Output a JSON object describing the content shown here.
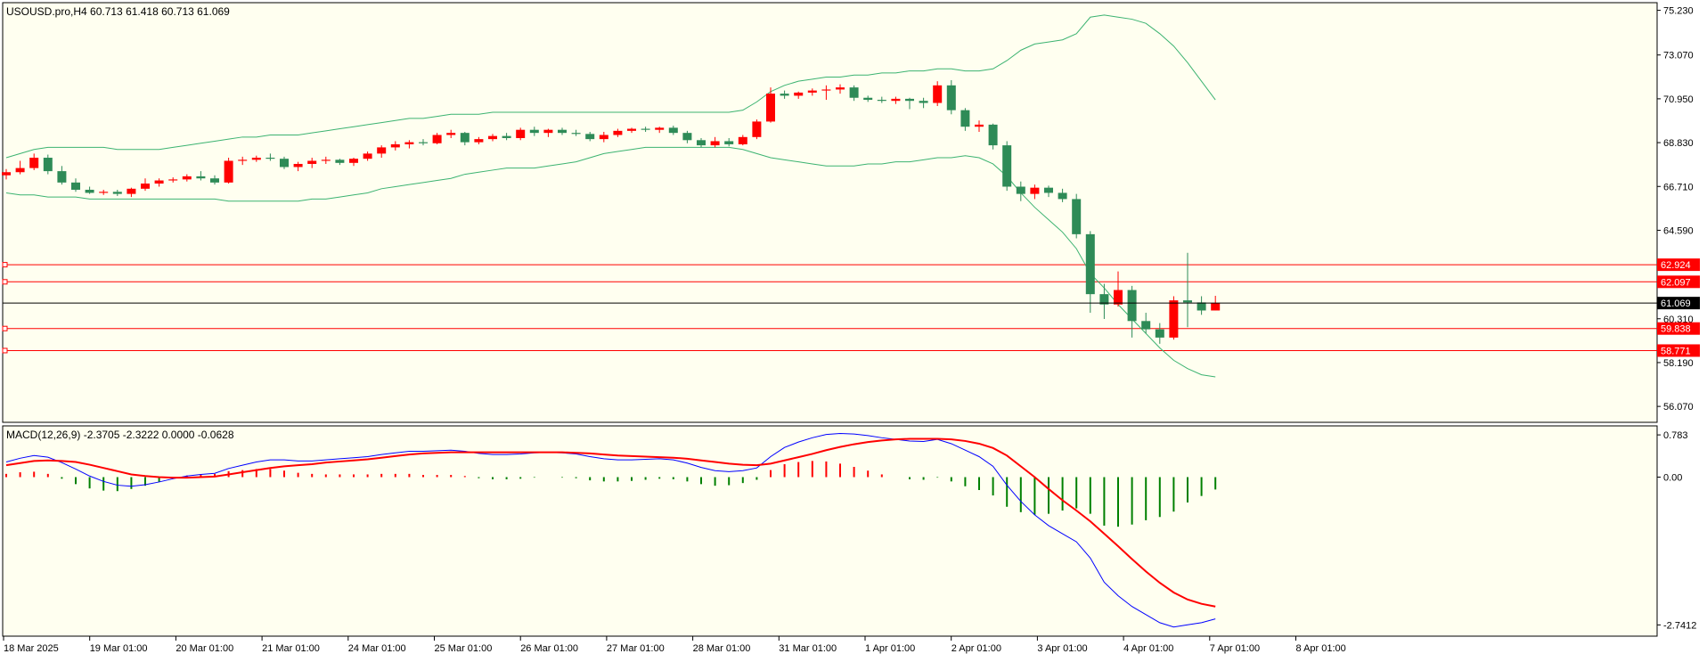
{
  "header": {
    "symbol_info": "USOUSD.pro,H4  60.713 61.418 60.713 61.069",
    "macd_info": "MACD(12,26,9) -2.3705 -2.3222 0.0000 -0.0628"
  },
  "colors": {
    "background": "#FFFFF0",
    "bull_candle": "#FF0000",
    "bear_candle": "#2E8B57",
    "bands": "#3CB371",
    "level_lines": "#FF0000",
    "price_line": "#000000",
    "macd_main": "#0000FF",
    "macd_signal": "#FF0000",
    "hist_pos": "#FF0000",
    "hist_neg": "#008000"
  },
  "chart_data": [
    {
      "type": "candlestick",
      "title": "USOUSD.pro,H4",
      "ylim": [
        55.3,
        75.6
      ],
      "y_ticks": [
        "75.230",
        "73.070",
        "70.950",
        "68.830",
        "66.710",
        "64.590",
        "60.310",
        "58.190",
        "56.070"
      ],
      "current_price": "61.069",
      "horizontal_levels": [
        "62.924",
        "62.097",
        "59.838",
        "58.771"
      ],
      "x_ticks": [
        "18 Mar 2025",
        "19 Mar 01:00",
        "20 Mar 01:00",
        "21 Mar 01:00",
        "24 Mar 01:00",
        "25 Mar 01:00",
        "26 Mar 01:00",
        "27 Mar 01:00",
        "28 Mar 01:00",
        "31 Mar 01:00",
        "1 Apr 01:00",
        "2 Apr 01:00",
        "3 Apr 01:00",
        "4 Apr 01:00",
        "7 Apr 01:00",
        "8 Apr 01:00"
      ],
      "ohlc": [
        [
          67.25,
          67.55,
          67.05,
          67.4
        ],
        [
          67.4,
          67.95,
          67.3,
          67.6
        ],
        [
          67.6,
          68.3,
          67.5,
          68.1
        ],
        [
          68.1,
          68.25,
          67.3,
          67.45
        ],
        [
          67.45,
          67.7,
          66.8,
          66.9
        ],
        [
          66.9,
          67.1,
          66.45,
          66.55
        ],
        [
          66.55,
          66.7,
          66.35,
          66.4
        ],
        [
          66.4,
          66.55,
          66.3,
          66.45
        ],
        [
          66.45,
          66.55,
          66.25,
          66.35
        ],
        [
          66.35,
          66.65,
          66.2,
          66.6
        ],
        [
          66.6,
          67.1,
          66.5,
          66.85
        ],
        [
          66.85,
          67.1,
          66.7,
          67.0
        ],
        [
          67.0,
          67.15,
          66.9,
          67.05
        ],
        [
          67.05,
          67.3,
          66.95,
          67.2
        ],
        [
          67.2,
          67.45,
          67.0,
          67.1
        ],
        [
          67.1,
          67.25,
          66.8,
          66.9
        ],
        [
          66.9,
          68.1,
          66.85,
          67.95
        ],
        [
          67.95,
          68.15,
          67.75,
          68.0
        ],
        [
          68.0,
          68.2,
          67.9,
          68.1
        ],
        [
          68.1,
          68.3,
          67.95,
          68.05
        ],
        [
          68.05,
          68.15,
          67.55,
          67.65
        ],
        [
          67.65,
          67.9,
          67.45,
          67.8
        ],
        [
          67.8,
          68.1,
          67.6,
          67.95
        ],
        [
          67.95,
          68.15,
          67.8,
          68.0
        ],
        [
          68.0,
          68.05,
          67.75,
          67.85
        ],
        [
          67.85,
          68.1,
          67.7,
          68.05
        ],
        [
          68.05,
          68.4,
          67.95,
          68.3
        ],
        [
          68.3,
          68.7,
          68.1,
          68.6
        ],
        [
          68.6,
          68.9,
          68.45,
          68.75
        ],
        [
          68.75,
          68.95,
          68.55,
          68.85
        ],
        [
          68.85,
          69.0,
          68.7,
          68.8
        ],
        [
          68.8,
          69.3,
          68.75,
          69.2
        ],
        [
          69.2,
          69.45,
          69.05,
          69.3
        ],
        [
          69.3,
          69.35,
          68.7,
          68.85
        ],
        [
          68.85,
          69.1,
          68.75,
          69.0
        ],
        [
          69.0,
          69.25,
          68.9,
          69.15
        ],
        [
          69.15,
          69.3,
          68.95,
          69.05
        ],
        [
          69.05,
          69.55,
          68.95,
          69.45
        ],
        [
          69.45,
          69.6,
          69.15,
          69.3
        ],
        [
          69.3,
          69.5,
          69.1,
          69.45
        ],
        [
          69.45,
          69.55,
          69.2,
          69.3
        ],
        [
          69.3,
          69.45,
          69.15,
          69.25
        ],
        [
          69.25,
          69.35,
          68.9,
          69.0
        ],
        [
          69.0,
          69.35,
          68.85,
          69.2
        ],
        [
          69.2,
          69.5,
          69.1,
          69.4
        ],
        [
          69.4,
          69.55,
          69.3,
          69.5
        ],
        [
          69.5,
          69.6,
          69.35,
          69.45
        ],
        [
          69.45,
          69.6,
          69.3,
          69.55
        ],
        [
          69.55,
          69.65,
          69.2,
          69.3
        ],
        [
          69.3,
          69.4,
          68.8,
          68.95
        ],
        [
          68.95,
          69.05,
          68.6,
          68.7
        ],
        [
          68.7,
          69.1,
          68.6,
          68.9
        ],
        [
          68.9,
          69.05,
          68.65,
          68.75
        ],
        [
          68.75,
          69.2,
          68.7,
          69.1
        ],
        [
          69.1,
          69.95,
          69.0,
          69.85
        ],
        [
          69.85,
          71.5,
          69.8,
          71.2
        ],
        [
          71.2,
          71.35,
          70.95,
          71.1
        ],
        [
          71.1,
          71.3,
          70.95,
          71.25
        ],
        [
          71.25,
          71.45,
          71.1,
          71.35
        ],
        [
          71.35,
          71.6,
          70.9,
          71.4
        ],
        [
          71.4,
          71.65,
          71.2,
          71.5
        ],
        [
          71.5,
          71.6,
          70.85,
          71.0
        ],
        [
          71.0,
          71.1,
          70.8,
          70.9
        ],
        [
          70.9,
          71.05,
          70.75,
          70.85
        ],
        [
          70.85,
          71.05,
          70.7,
          70.95
        ],
        [
          70.95,
          71.0,
          70.45,
          70.85
        ],
        [
          70.85,
          71.0,
          70.5,
          70.75
        ],
        [
          70.75,
          71.8,
          70.6,
          71.6
        ],
        [
          71.6,
          71.85,
          70.2,
          70.4
        ],
        [
          70.4,
          70.5,
          69.4,
          69.6
        ],
        [
          69.6,
          69.9,
          69.35,
          69.7
        ],
        [
          69.7,
          69.75,
          68.5,
          68.7
        ],
        [
          68.7,
          68.9,
          66.5,
          66.7
        ],
        [
          66.7,
          66.95,
          66.0,
          66.35
        ],
        [
          66.35,
          66.8,
          66.1,
          66.65
        ],
        [
          66.65,
          66.75,
          66.2,
          66.4
        ],
        [
          66.4,
          66.6,
          65.95,
          66.1
        ],
        [
          66.1,
          66.35,
          64.2,
          64.4
        ],
        [
          64.4,
          64.55,
          60.6,
          61.5
        ],
        [
          61.5,
          62.0,
          60.3,
          61.0
        ],
        [
          61.0,
          62.6,
          60.9,
          61.7
        ],
        [
          61.7,
          61.9,
          59.4,
          60.2
        ],
        [
          60.2,
          60.6,
          59.6,
          59.8
        ],
        [
          59.8,
          60.1,
          59.1,
          59.4
        ],
        [
          59.4,
          61.4,
          59.3,
          61.2
        ],
        [
          61.2,
          63.5,
          59.9,
          61.1
        ],
        [
          61.1,
          61.4,
          60.5,
          60.71
        ],
        [
          60.71,
          61.42,
          60.71,
          61.07
        ]
      ],
      "bollinger": {
        "upper": [
          68.1,
          68.3,
          68.5,
          68.6,
          68.6,
          68.6,
          68.6,
          68.6,
          68.5,
          68.5,
          68.5,
          68.5,
          68.6,
          68.7,
          68.8,
          68.9,
          69.0,
          69.1,
          69.1,
          69.2,
          69.2,
          69.2,
          69.3,
          69.4,
          69.5,
          69.6,
          69.7,
          69.8,
          69.9,
          70.0,
          70.0,
          70.1,
          70.2,
          70.2,
          70.2,
          70.3,
          70.3,
          70.3,
          70.3,
          70.3,
          70.3,
          70.3,
          70.3,
          70.3,
          70.3,
          70.3,
          70.3,
          70.3,
          70.3,
          70.3,
          70.3,
          70.3,
          70.3,
          70.4,
          70.8,
          71.3,
          71.6,
          71.8,
          71.9,
          72.0,
          72.0,
          72.1,
          72.1,
          72.2,
          72.2,
          72.3,
          72.3,
          72.4,
          72.4,
          72.3,
          72.3,
          72.4,
          72.8,
          73.3,
          73.6,
          73.7,
          73.8,
          74.1,
          74.9,
          75.0,
          74.9,
          74.8,
          74.6,
          74.1,
          73.5,
          72.7,
          71.8,
          70.9
        ],
        "lower": [
          66.4,
          66.3,
          66.3,
          66.2,
          66.2,
          66.2,
          66.1,
          66.1,
          66.1,
          66.1,
          66.1,
          66.1,
          66.1,
          66.1,
          66.1,
          66.1,
          66.0,
          66.0,
          66.0,
          66.0,
          66.0,
          66.0,
          66.1,
          66.1,
          66.2,
          66.3,
          66.4,
          66.6,
          66.7,
          66.8,
          66.9,
          67.0,
          67.1,
          67.3,
          67.4,
          67.5,
          67.6,
          67.6,
          67.6,
          67.7,
          67.8,
          67.9,
          68.1,
          68.3,
          68.4,
          68.5,
          68.6,
          68.6,
          68.6,
          68.6,
          68.6,
          68.6,
          68.6,
          68.5,
          68.3,
          68.1,
          68.0,
          67.9,
          67.8,
          67.7,
          67.7,
          67.7,
          67.8,
          67.8,
          67.9,
          67.9,
          68.0,
          68.1,
          68.1,
          68.2,
          68.1,
          67.8,
          67.2,
          66.4,
          65.7,
          65.1,
          64.5,
          63.7,
          62.5,
          61.8,
          61.0,
          60.3,
          59.6,
          58.9,
          58.3,
          57.9,
          57.6,
          57.5
        ]
      }
    },
    {
      "type": "macd",
      "title": "MACD(12,26,9)",
      "ylim": [
        -2.95,
        0.95
      ],
      "y_ticks": [
        "0.783",
        "0.00",
        "-2.7412"
      ],
      "main": [
        0.28,
        0.35,
        0.4,
        0.37,
        0.27,
        0.15,
        0.02,
        -0.08,
        -0.15,
        -0.17,
        -0.14,
        -0.09,
        -0.03,
        0.02,
        0.05,
        0.07,
        0.16,
        0.22,
        0.28,
        0.32,
        0.32,
        0.3,
        0.3,
        0.32,
        0.34,
        0.36,
        0.38,
        0.42,
        0.45,
        0.48,
        0.48,
        0.49,
        0.5,
        0.48,
        0.44,
        0.42,
        0.42,
        0.43,
        0.45,
        0.46,
        0.45,
        0.43,
        0.38,
        0.34,
        0.32,
        0.32,
        0.33,
        0.34,
        0.32,
        0.26,
        0.18,
        0.12,
        0.1,
        0.12,
        0.17,
        0.38,
        0.55,
        0.65,
        0.73,
        0.79,
        0.81,
        0.8,
        0.77,
        0.73,
        0.7,
        0.67,
        0.66,
        0.7,
        0.62,
        0.5,
        0.38,
        0.2,
        -0.15,
        -0.45,
        -0.7,
        -0.9,
        -1.05,
        -1.2,
        -1.5,
        -1.95,
        -2.2,
        -2.4,
        -2.55,
        -2.7,
        -2.78,
        -2.74,
        -2.7,
        -2.63
      ],
      "signal": [
        0.22,
        0.26,
        0.3,
        0.31,
        0.3,
        0.28,
        0.23,
        0.17,
        0.11,
        0.05,
        0.02,
        0.0,
        -0.01,
        -0.01,
        0.0,
        0.01,
        0.05,
        0.09,
        0.13,
        0.17,
        0.2,
        0.22,
        0.24,
        0.27,
        0.29,
        0.31,
        0.33,
        0.36,
        0.39,
        0.42,
        0.44,
        0.45,
        0.46,
        0.46,
        0.46,
        0.46,
        0.46,
        0.46,
        0.46,
        0.46,
        0.46,
        0.45,
        0.44,
        0.42,
        0.4,
        0.39,
        0.38,
        0.37,
        0.36,
        0.34,
        0.31,
        0.28,
        0.25,
        0.23,
        0.22,
        0.25,
        0.31,
        0.37,
        0.43,
        0.5,
        0.56,
        0.61,
        0.65,
        0.68,
        0.7,
        0.71,
        0.71,
        0.71,
        0.7,
        0.67,
        0.62,
        0.54,
        0.4,
        0.2,
        0.0,
        -0.22,
        -0.43,
        -0.62,
        -0.82,
        -1.05,
        -1.28,
        -1.52,
        -1.75,
        -1.96,
        -2.14,
        -2.27,
        -2.35,
        -2.4
      ],
      "histogram": [
        0.06,
        0.09,
        0.1,
        0.06,
        -0.03,
        -0.13,
        -0.21,
        -0.25,
        -0.26,
        -0.22,
        -0.16,
        -0.09,
        -0.02,
        0.03,
        0.05,
        0.06,
        0.11,
        0.13,
        0.15,
        0.15,
        0.12,
        0.08,
        0.06,
        0.05,
        0.05,
        0.05,
        0.05,
        0.06,
        0.06,
        0.06,
        0.04,
        0.04,
        0.04,
        0.02,
        -0.02,
        -0.04,
        -0.04,
        -0.03,
        -0.01,
        0.0,
        -0.01,
        -0.02,
        -0.06,
        -0.08,
        -0.08,
        -0.07,
        -0.05,
        -0.03,
        -0.04,
        -0.08,
        -0.13,
        -0.16,
        -0.15,
        -0.11,
        -0.05,
        0.13,
        0.24,
        0.28,
        0.3,
        0.29,
        0.25,
        0.19,
        0.12,
        0.05,
        0.0,
        -0.04,
        -0.05,
        -0.01,
        -0.08,
        -0.17,
        -0.24,
        -0.34,
        -0.55,
        -0.65,
        -0.7,
        -0.68,
        -0.62,
        -0.58,
        -0.68,
        -0.9,
        -0.92,
        -0.88,
        -0.8,
        -0.74,
        -0.64,
        -0.47,
        -0.35,
        -0.23
      ]
    }
  ]
}
